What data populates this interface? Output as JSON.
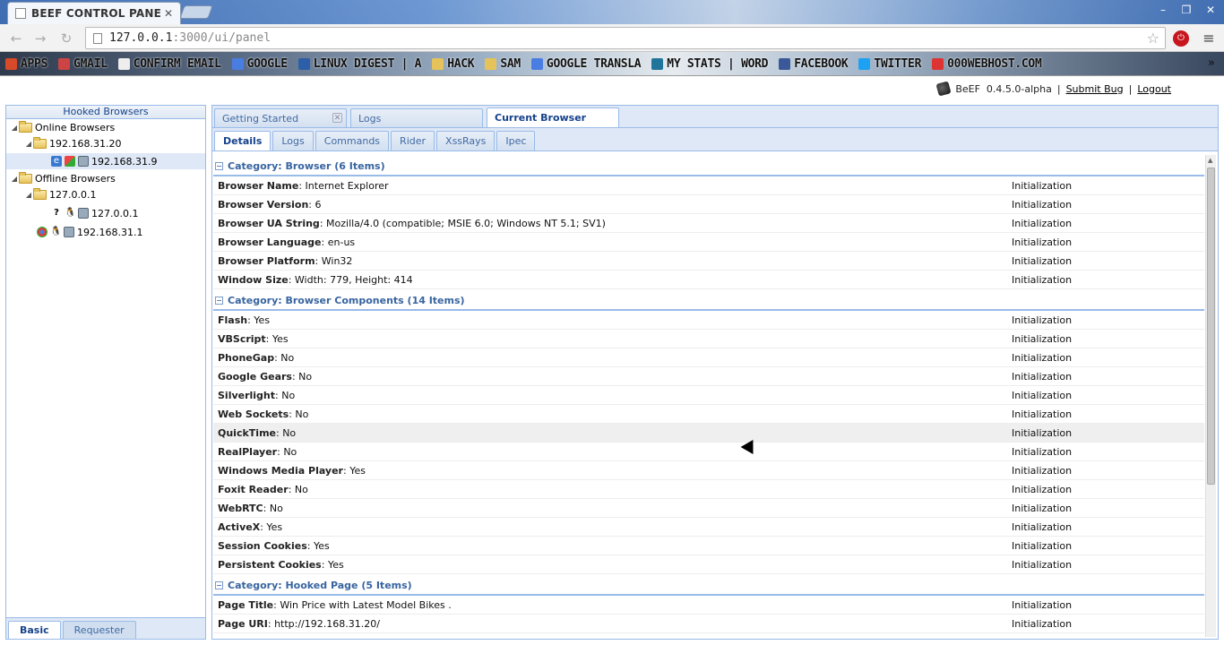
{
  "browser": {
    "tab_title": "BEEF CONTROL PANEL",
    "url_host": "127.0.0.1",
    "url_rest": ":3000/ui/panel",
    "bookmarks": [
      {
        "label": "APPS",
        "icon": "apps-grid-icon",
        "color": "#d64a2a"
      },
      {
        "label": "GMAIL",
        "icon": "gmail-icon",
        "color": "#c44"
      },
      {
        "label": "CONFIRM EMAIL",
        "icon": "page-icon",
        "color": "#eee"
      },
      {
        "label": "GOOGLE",
        "icon": "google-icon",
        "color": "#4a7de2"
      },
      {
        "label": "LINUX DIGEST | A",
        "icon": "linux-digest-icon",
        "color": "#2d5ea8"
      },
      {
        "label": "HACK",
        "icon": "folder-icon",
        "color": "#e6c35a"
      },
      {
        "label": "SAM",
        "icon": "folder-icon",
        "color": "#e6c35a"
      },
      {
        "label": "GOOGLE TRANSLA",
        "icon": "translate-icon",
        "color": "#4a7de2"
      },
      {
        "label": "MY STATS | WORD",
        "icon": "wordpress-icon",
        "color": "#21759b"
      },
      {
        "label": "FACEBOOK",
        "icon": "facebook-icon",
        "color": "#3b5998"
      },
      {
        "label": "TWITTER",
        "icon": "twitter-icon",
        "color": "#1da1f2"
      },
      {
        "label": "000WEBHOST.COM",
        "icon": "webhost-icon",
        "color": "#d33"
      }
    ]
  },
  "header": {
    "app_name": "BeEF",
    "version": "0.4.5.0-alpha",
    "submit_bug": "Submit Bug",
    "logout": "Logout"
  },
  "left": {
    "title": "Hooked Browsers",
    "online": "Online Browsers",
    "online_host": "192.168.31.20",
    "online_browser": "192.168.31.9",
    "offline": "Offline Browsers",
    "offline_host": "127.0.0.1",
    "offline_browser": "127.0.0.1",
    "offline_browser2": "192.168.31.1",
    "tab_basic": "Basic",
    "tab_requester": "Requester"
  },
  "main_tabs": [
    {
      "label": "Getting Started",
      "closable": true
    },
    {
      "label": "Logs",
      "closable": false
    },
    {
      "label": "Current Browser",
      "closable": false
    }
  ],
  "sub_tabs": [
    "Details",
    "Logs",
    "Commands",
    "Rider",
    "XssRays",
    "Ipec"
  ],
  "categories": [
    {
      "label": "Category: Browser (6 Items)",
      "rows": [
        {
          "key": "Browser Name",
          "value": "Internet Explorer",
          "source": "Initialization"
        },
        {
          "key": "Browser Version",
          "value": "6",
          "source": "Initialization"
        },
        {
          "key": "Browser UA String",
          "value": "Mozilla/4.0 (compatible; MSIE 6.0; Windows NT 5.1; SV1)",
          "source": "Initialization"
        },
        {
          "key": "Browser Language",
          "value": "en-us",
          "source": "Initialization"
        },
        {
          "key": "Browser Platform",
          "value": "Win32",
          "source": "Initialization"
        },
        {
          "key": "Window Size",
          "value": "Width: 779, Height: 414",
          "source": "Initialization"
        }
      ]
    },
    {
      "label": "Category: Browser Components (14 Items)",
      "rows": [
        {
          "key": "Flash",
          "value": "Yes",
          "source": "Initialization"
        },
        {
          "key": "VBScript",
          "value": "Yes",
          "source": "Initialization"
        },
        {
          "key": "PhoneGap",
          "value": "No",
          "source": "Initialization"
        },
        {
          "key": "Google Gears",
          "value": "No",
          "source": "Initialization"
        },
        {
          "key": "Silverlight",
          "value": "No",
          "source": "Initialization"
        },
        {
          "key": "Web Sockets",
          "value": "No",
          "source": "Initialization"
        },
        {
          "key": "QuickTime",
          "value": "No",
          "source": "Initialization"
        },
        {
          "key": "RealPlayer",
          "value": "No",
          "source": "Initialization"
        },
        {
          "key": "Windows Media Player",
          "value": "Yes",
          "source": "Initialization"
        },
        {
          "key": "Foxit Reader",
          "value": "No",
          "source": "Initialization"
        },
        {
          "key": "WebRTC",
          "value": "No",
          "source": "Initialization"
        },
        {
          "key": "ActiveX",
          "value": "Yes",
          "source": "Initialization"
        },
        {
          "key": "Session Cookies",
          "value": "Yes",
          "source": "Initialization"
        },
        {
          "key": "Persistent Cookies",
          "value": "Yes",
          "source": "Initialization"
        }
      ]
    },
    {
      "label": "Category: Hooked Page (5 Items)",
      "rows": [
        {
          "key": "Page Title",
          "value": "Win Price with Latest Model Bikes .",
          "source": "Initialization"
        },
        {
          "key": "Page URI",
          "value": "http://192.168.31.20/",
          "source": "Initialization"
        }
      ]
    }
  ]
}
